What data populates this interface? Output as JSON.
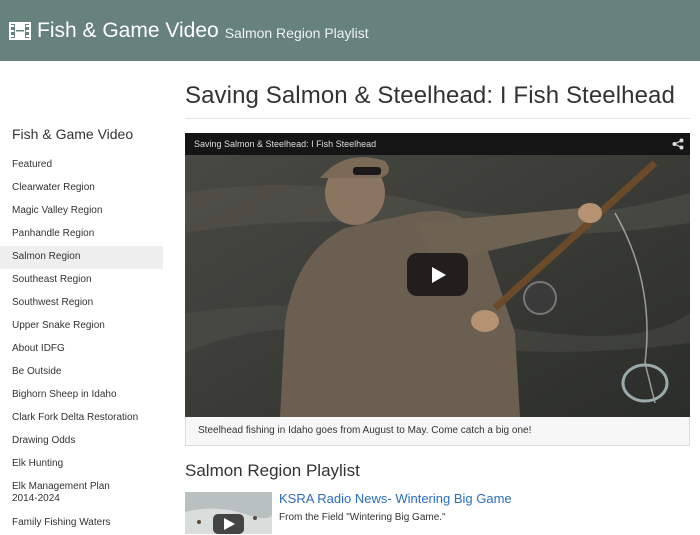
{
  "header": {
    "icon": "film-icon",
    "title": "Fish & Game Video",
    "subtitle": "Salmon Region Playlist"
  },
  "sidebar": {
    "heading": "Fish & Game Video",
    "items": [
      {
        "label": "Featured"
      },
      {
        "label": "Clearwater Region"
      },
      {
        "label": "Magic Valley Region"
      },
      {
        "label": "Panhandle Region"
      },
      {
        "label": "Salmon Region",
        "active": true
      },
      {
        "label": "Southeast Region"
      },
      {
        "label": "Southwest Region"
      },
      {
        "label": "Upper Snake Region"
      },
      {
        "label": "About IDFG"
      },
      {
        "label": "Be Outside"
      },
      {
        "label": "Bighorn Sheep in Idaho"
      },
      {
        "label": "Clark Fork Delta Restoration"
      },
      {
        "label": "Drawing Odds"
      },
      {
        "label": "Elk Hunting"
      },
      {
        "label": "Elk Management Plan 2014-2024"
      },
      {
        "label": "Family Fishing Waters"
      }
    ]
  },
  "main": {
    "title": "Saving Salmon & Steelhead: I Fish Steelhead",
    "video": {
      "bar_title": "Saving Salmon & Steelhead: I Fish Steelhead",
      "share_icon": "share-icon",
      "play_icon": "play-icon",
      "caption": "Steelhead fishing in Idaho goes from August to May. Come catch a big one!"
    },
    "playlist": {
      "heading": "Salmon Region Playlist",
      "items": [
        {
          "title": "KSRA Radio News- Wintering Big Game",
          "description": "From the Field \"Wintering Big Game.\""
        }
      ]
    }
  },
  "colors": {
    "header_bg": "#67817c",
    "link": "#2a6ebb",
    "active_bg": "#eeeeee"
  }
}
